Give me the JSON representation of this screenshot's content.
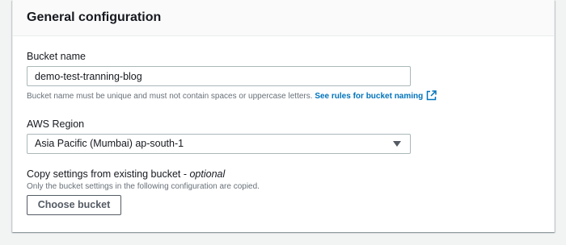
{
  "section": {
    "title": "General configuration"
  },
  "bucket_name": {
    "label": "Bucket name",
    "value": "demo-test-tranning-blog",
    "hint": "Bucket name must be unique and must not contain spaces or uppercase letters.",
    "rules_link": "See rules for bucket naming",
    "link_icon": "external-link-icon",
    "link_color": "#0073bb"
  },
  "region": {
    "label": "AWS Region",
    "selected": "Asia Pacific (Mumbai) ap-south-1",
    "caret_icon": "caret-down-icon"
  },
  "copy_settings": {
    "label": "Copy settings from existing bucket - ",
    "optional": "optional",
    "description": "Only the bucket settings in the following configuration are copied.",
    "button_label": "Choose bucket"
  }
}
